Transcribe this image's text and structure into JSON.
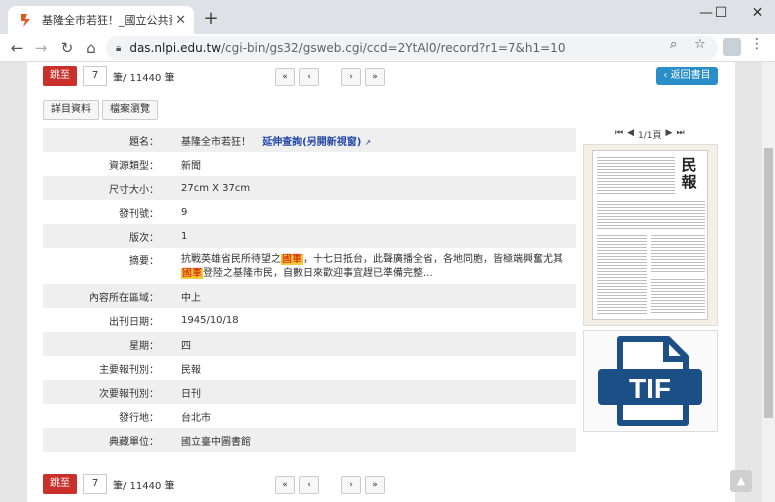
{
  "browser": {
    "tab_title": "基隆全市若狂！_國立公共資訊圖",
    "url_host": "das.nlpi.edu.tw",
    "url_path": "/cgi-bin/gs32/gsweb.cgi/ccd=2YtAl0/record?r1=7&h1=10",
    "new_tab_symbol": "+",
    "win_min": "—",
    "win_max": "☐",
    "win_close": "✕"
  },
  "pager": {
    "jump_label": "跳至",
    "page_value": "7",
    "total_label": "筆/ 11440 筆",
    "first": "«",
    "prev": "‹",
    "next": "›",
    "last": "»",
    "back_label": "返回書目"
  },
  "view_tabs": [
    "詳目資料",
    "檔案瀏覽"
  ],
  "record": {
    "title_key": "題名：",
    "title_val": "基隆全市若狂！",
    "extended_link": "延伸查詢(另開新視窗)",
    "rows": [
      {
        "k": "資源類型：",
        "v": "新聞"
      },
      {
        "k": "尺寸大小：",
        "v": "27cm X 37cm"
      },
      {
        "k": "發刊號：",
        "v": "9"
      },
      {
        "k": "版次：",
        "v": "1"
      }
    ],
    "abstract_key": "摘要：",
    "abstract_pre": "抗戰英雄省民所待望之",
    "abstract_hl1": "國軍",
    "abstract_mid": "，十七日抵台，此聲廣播全省，各地同胞，皆極端興奮尤其",
    "abstract_hl2": "國軍",
    "abstract_post": "登陸之基隆市民，自數日來歡迎事宜趕已準備完整...",
    "rows2": [
      {
        "k": "內容所在區域：",
        "v": "中上"
      },
      {
        "k": "出刊日期：",
        "v": "1945/10/18"
      },
      {
        "k": "星期：",
        "v": "四"
      },
      {
        "k": "主要報刊別：",
        "v": "民報"
      },
      {
        "k": "次要報刊別：",
        "v": "日刊"
      },
      {
        "k": "發行地：",
        "v": "台北市"
      },
      {
        "k": "典藏單位：",
        "v": "國立臺中圖書館"
      }
    ]
  },
  "image_viewer": {
    "page_indicator": "1/1頁",
    "newspaper_masthead": "民報",
    "file_type_label": "TIF"
  },
  "colors": {
    "jump_red": "#c9302c",
    "back_blue": "#2a8ec9",
    "highlight": "#f7c93a",
    "tif_blue": "#1c4f86"
  }
}
